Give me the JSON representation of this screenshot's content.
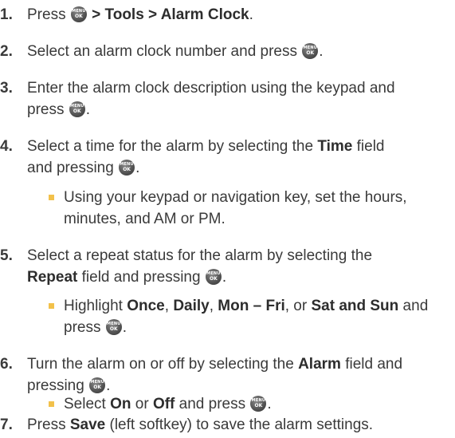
{
  "steps": [
    {
      "number": "1.",
      "pre": "Press",
      "path": " > Tools > Alarm Clock",
      "post": "."
    },
    {
      "number": "2.",
      "pre": "Select an alarm clock number and press",
      "post": "."
    },
    {
      "number": "3.",
      "line1": "Enter the alarm clock description using the keypad and",
      "line2_pre": "press",
      "line2_post": "."
    },
    {
      "number": "4.",
      "line1_pre": "Select a time for the alarm by selecting the ",
      "line1_bold": "Time",
      "line1_post": " field",
      "line2_pre": "and pressing",
      "line2_post": "."
    },
    {
      "number": "5.",
      "line1": "Select a repeat status for the alarm by selecting the",
      "line2_bold": "Repeat",
      "line2_pre": " field and pressing",
      "line2_post": "."
    },
    {
      "number": "6.",
      "line1_pre": "Turn the alarm on or off by selecting the ",
      "line1_bold": "Alarm",
      "line1_post": " field and",
      "line2_pre": "pressing",
      "line2_post": "."
    },
    {
      "number": "7.",
      "pre": "Press ",
      "bold": "Save",
      "post": " (left softkey) to save the alarm settings."
    }
  ],
  "bullets": [
    {
      "line1": "Using your keypad or navigation key, set the hours,",
      "line2": "minutes, and AM or PM."
    },
    {
      "pre": "Highlight ",
      "o1": "Once",
      "s1": ", ",
      "o2": "Daily",
      "s2": ", ",
      "o3": "Mon – Fri",
      "s3": ", or ",
      "o4": "Sat and Sun",
      "post": " and",
      "line2": "press",
      "line2_post": "."
    },
    {
      "pre": "Select ",
      "o1": "On",
      "s1": " or ",
      "o2": "Off",
      "post": " and press",
      "end": "."
    }
  ],
  "ok_key": {
    "top": "MENU",
    "bottom": "OK"
  },
  "colors": {
    "text": "#3a3a3a",
    "bullet": "#f2c14b",
    "key": "#555555"
  }
}
